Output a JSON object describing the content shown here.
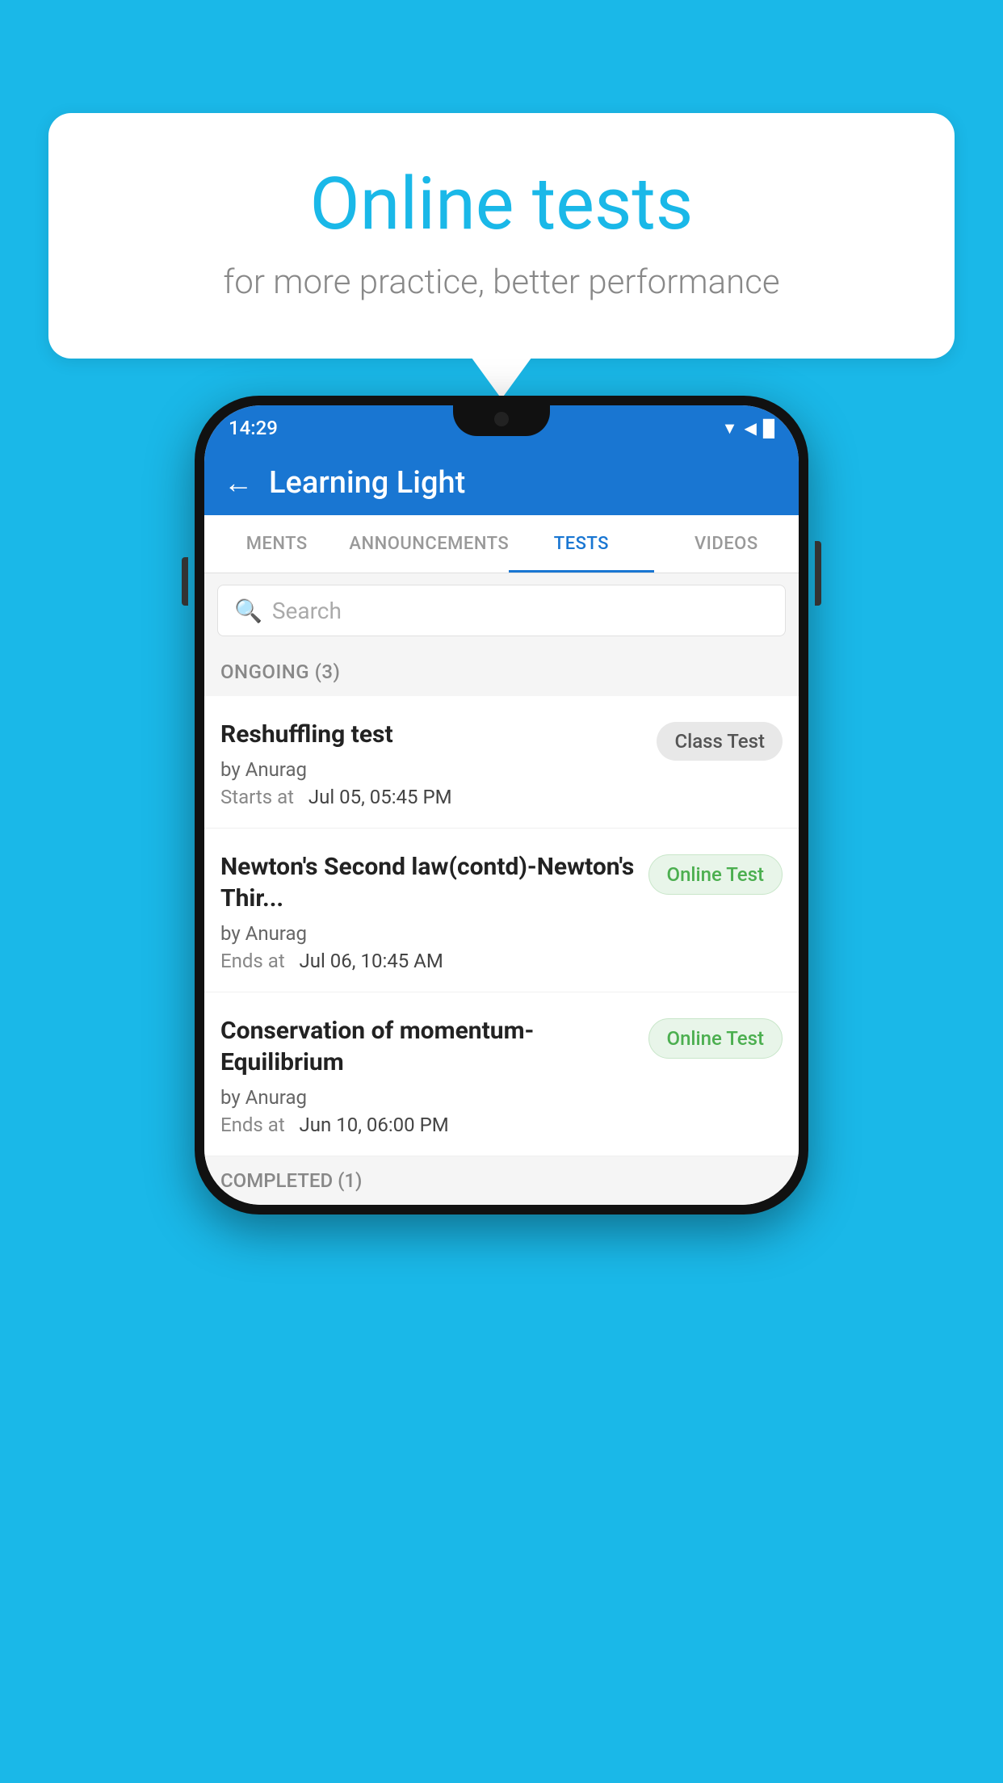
{
  "background": {
    "color": "#1ab8e8"
  },
  "bubble": {
    "title": "Online tests",
    "subtitle": "for more practice, better performance"
  },
  "phone": {
    "status_bar": {
      "time": "14:29",
      "icons": "▼◀█"
    },
    "app_header": {
      "title": "Learning Light",
      "back_label": "←"
    },
    "tabs": [
      {
        "label": "MENTS",
        "active": false
      },
      {
        "label": "ANNOUNCEMENTS",
        "active": false
      },
      {
        "label": "TESTS",
        "active": true
      },
      {
        "label": "VIDEOS",
        "active": false
      }
    ],
    "search": {
      "placeholder": "Search"
    },
    "ongoing_section": {
      "label": "ONGOING (3)"
    },
    "tests": [
      {
        "name": "Reshuffling test",
        "by": "by Anurag",
        "time_label": "Starts at",
        "time_value": "Jul 05, 05:45 PM",
        "badge": "Class Test",
        "badge_type": "class"
      },
      {
        "name": "Newton's Second law(contd)-Newton's Thir...",
        "by": "by Anurag",
        "time_label": "Ends at",
        "time_value": "Jul 06, 10:45 AM",
        "badge": "Online Test",
        "badge_type": "online"
      },
      {
        "name": "Conservation of momentum-Equilibrium",
        "by": "by Anurag",
        "time_label": "Ends at",
        "time_value": "Jun 10, 06:00 PM",
        "badge": "Online Test",
        "badge_type": "online"
      }
    ],
    "completed_section": {
      "label": "COMPLETED (1)"
    }
  }
}
